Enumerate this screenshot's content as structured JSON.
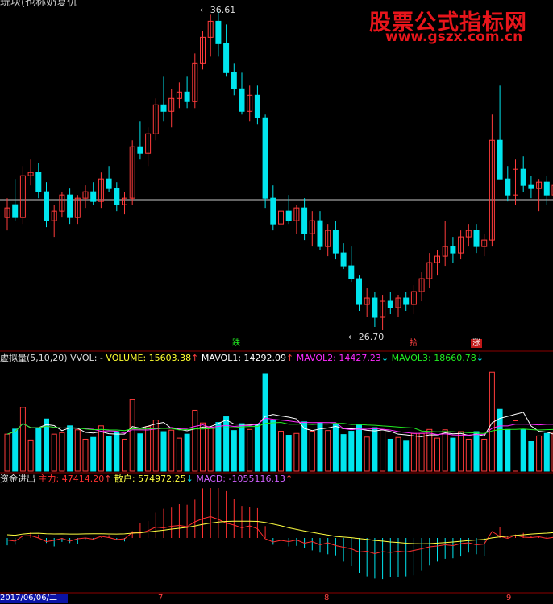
{
  "top_title_cut": "玩块(也称奶复仇",
  "watermark": {
    "line1": "股票公式指标网",
    "line2": "www.gszx.com.cn"
  },
  "price_panel": {
    "high_label": "36.61",
    "low_label": "26.70",
    "markers": {
      "fall": "跌",
      "pickup": "拾",
      "rise": "涨"
    }
  },
  "volume_panel": {
    "title": "虚拟量(5,10,20)",
    "vvol": "VVOL: -",
    "volume": "VOLUME: 15603.38",
    "mavol1": "MAVOL1: 14292.09",
    "mavol2": "MAVOL2: 14427.23",
    "mavol3": "MAVOL3: 18660.78"
  },
  "fund_panel": {
    "title": "资金进出",
    "main_force": "主力: 47414.20",
    "retail": "散户: 574972.25",
    "macd": "MACD: -1055116.13"
  },
  "bottom_axis": {
    "date": "2017/06/06/二",
    "ticks": [
      "7",
      "8",
      "9"
    ]
  },
  "colors": {
    "up": "#ff3b3b",
    "down": "#00e5ee",
    "volume_label": "#ffff30",
    "mavol1": "#ffffff",
    "mavol2": "#ff2bff",
    "mavol3": "#22ee22",
    "main_force": "#ff3030",
    "retail": "#ffff40",
    "macd": "#d060ff"
  },
  "chart_data": {
    "type": "candlestick",
    "candles": [
      [
        30.2,
        30.8,
        29.8,
        30.5
      ],
      [
        30.6,
        31.4,
        30.1,
        30.2
      ],
      [
        30.2,
        31.8,
        30.0,
        31.5
      ],
      [
        31.5,
        32.0,
        31.2,
        31.6
      ],
      [
        31.6,
        31.9,
        30.8,
        31.0
      ],
      [
        31.0,
        31.3,
        29.9,
        30.1
      ],
      [
        30.1,
        30.6,
        29.6,
        30.4
      ],
      [
        30.4,
        31.0,
        30.2,
        30.9
      ],
      [
        30.9,
        31.1,
        30.0,
        30.2
      ],
      [
        30.2,
        30.9,
        30.0,
        30.8
      ],
      [
        30.8,
        31.2,
        30.5,
        31.0
      ],
      [
        31.0,
        31.3,
        30.6,
        30.7
      ],
      [
        30.7,
        31.6,
        30.5,
        31.4
      ],
      [
        31.4,
        31.8,
        31.0,
        31.1
      ],
      [
        31.1,
        31.3,
        30.4,
        30.6
      ],
      [
        30.6,
        31.0,
        30.3,
        30.8
      ],
      [
        30.8,
        32.6,
        30.6,
        32.4
      ],
      [
        32.4,
        33.2,
        32.0,
        32.2
      ],
      [
        32.2,
        33.0,
        31.8,
        32.8
      ],
      [
        32.8,
        33.9,
        32.6,
        33.7
      ],
      [
        33.7,
        34.6,
        33.2,
        33.5
      ],
      [
        33.5,
        34.2,
        33.0,
        33.9
      ],
      [
        33.9,
        34.4,
        33.6,
        34.1
      ],
      [
        34.1,
        34.6,
        33.6,
        33.8
      ],
      [
        33.8,
        35.3,
        33.6,
        35.0
      ],
      [
        35.0,
        36.0,
        34.8,
        35.8
      ],
      [
        35.8,
        36.5,
        35.2,
        36.3
      ],
      [
        36.3,
        36.61,
        35.2,
        35.6
      ],
      [
        35.6,
        36.2,
        34.6,
        34.7
      ],
      [
        34.7,
        35.0,
        34.0,
        34.2
      ],
      [
        34.2,
        34.7,
        33.4,
        33.5
      ],
      [
        33.5,
        34.3,
        33.2,
        34.0
      ],
      [
        34.0,
        34.3,
        33.1,
        33.3
      ],
      [
        33.3,
        33.4,
        30.5,
        30.8
      ],
      [
        30.8,
        31.2,
        29.8,
        30.0
      ],
      [
        30.0,
        30.7,
        29.6,
        30.4
      ],
      [
        30.4,
        30.9,
        30.0,
        30.1
      ],
      [
        30.1,
        30.6,
        29.7,
        30.5
      ],
      [
        30.5,
        30.8,
        29.5,
        29.7
      ],
      [
        29.7,
        30.4,
        29.3,
        30.1
      ],
      [
        30.1,
        30.4,
        29.2,
        29.3
      ],
      [
        29.3,
        30.0,
        29.0,
        29.8
      ],
      [
        29.8,
        30.1,
        28.9,
        29.1
      ],
      [
        29.1,
        29.4,
        28.6,
        28.7
      ],
      [
        28.7,
        29.3,
        28.2,
        28.3
      ],
      [
        28.3,
        28.4,
        27.3,
        27.5
      ],
      [
        27.5,
        28.0,
        27.1,
        27.7
      ],
      [
        27.7,
        27.9,
        26.8,
        27.1
      ],
      [
        27.1,
        27.8,
        26.7,
        27.6
      ],
      [
        27.6,
        27.9,
        27.2,
        27.4
      ],
      [
        27.4,
        27.8,
        27.1,
        27.7
      ],
      [
        27.7,
        27.9,
        27.3,
        27.5
      ],
      [
        27.5,
        28.1,
        27.2,
        27.9
      ],
      [
        27.9,
        28.5,
        27.6,
        28.3
      ],
      [
        28.3,
        29.1,
        28.0,
        28.8
      ],
      [
        28.8,
        29.2,
        28.4,
        29.0
      ],
      [
        29.0,
        30.1,
        28.7,
        29.3
      ],
      [
        29.3,
        29.6,
        28.8,
        29.1
      ],
      [
        29.1,
        29.8,
        28.9,
        29.6
      ],
      [
        29.6,
        30.0,
        29.3,
        29.8
      ],
      [
        29.8,
        30.0,
        29.1,
        29.3
      ],
      [
        29.3,
        29.7,
        29.0,
        29.5
      ],
      [
        29.5,
        33.4,
        29.3,
        32.6
      ],
      [
        32.6,
        34.3,
        32.0,
        31.4
      ],
      [
        31.4,
        31.8,
        30.7,
        30.9
      ],
      [
        30.9,
        32.0,
        30.6,
        31.7
      ],
      [
        31.7,
        32.1,
        31.0,
        31.2
      ],
      [
        31.2,
        31.5,
        30.8,
        31.1
      ],
      [
        31.1,
        31.4,
        30.4,
        31.3
      ],
      [
        31.3,
        31.5,
        30.6,
        30.9
      ],
      [
        30.9,
        31.8,
        30.6,
        31.2
      ]
    ],
    "price_range": [
      26.7,
      36.61
    ]
  }
}
